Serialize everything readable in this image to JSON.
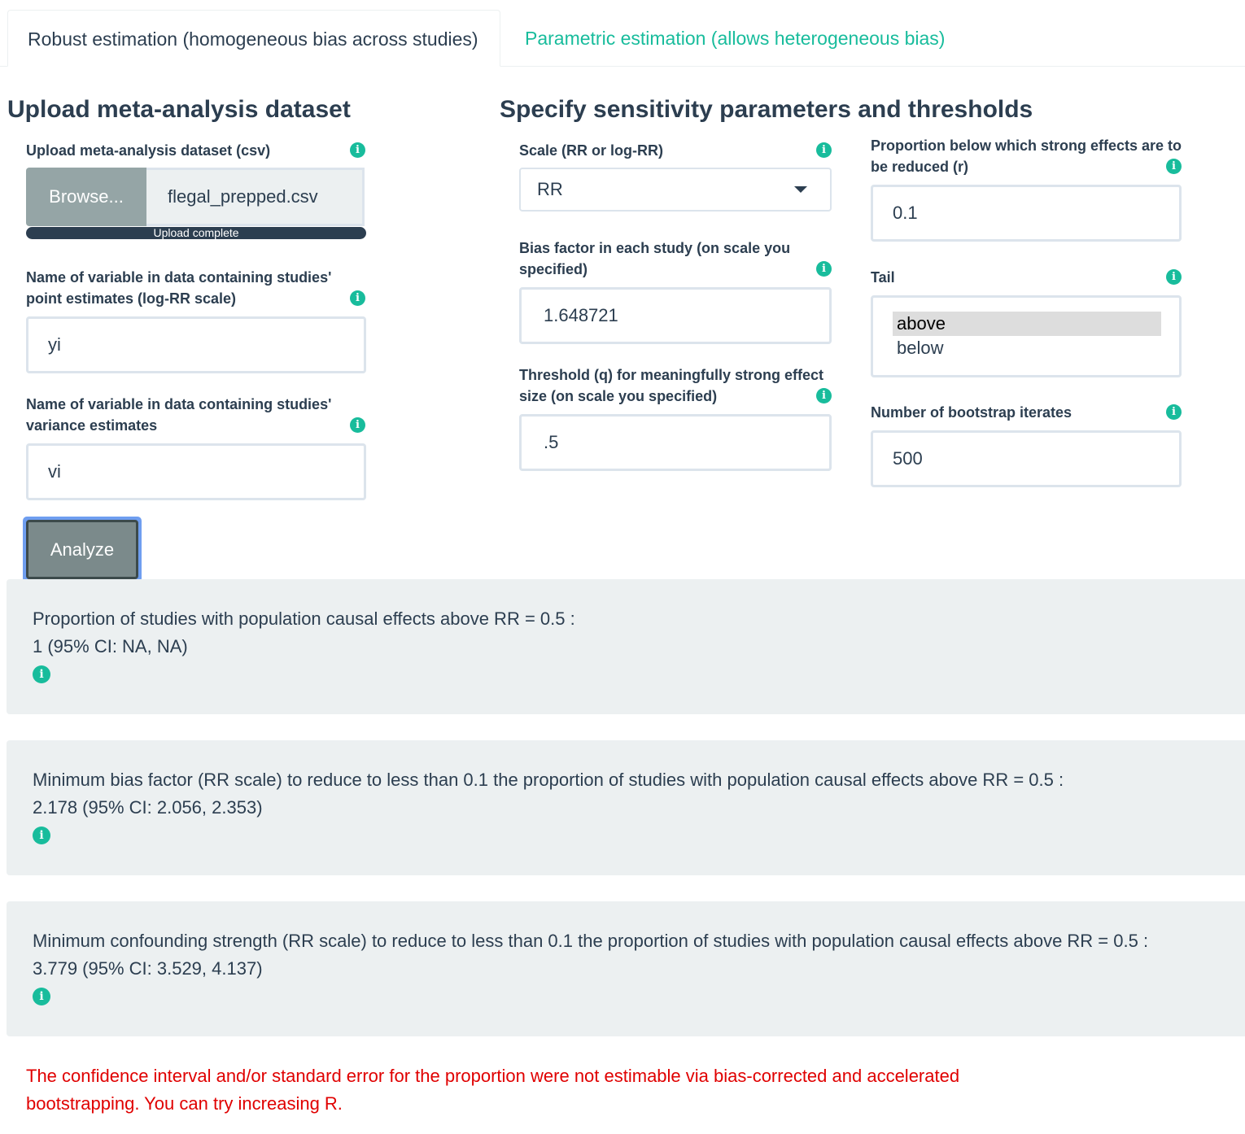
{
  "tabs": [
    {
      "label": "Robust estimation (homogeneous bias across studies)",
      "active": true
    },
    {
      "label": "Parametric estimation (allows heterogeneous bias)",
      "active": false
    }
  ],
  "upload_section": {
    "heading": "Upload meta-analysis dataset",
    "file_label": "Upload meta-analysis dataset (csv)",
    "browse_label": "Browse...",
    "file_name": "flegal_prepped.csv",
    "progress_text": "Upload complete",
    "point_label": "Name of variable in data containing studies' point estimates (log-RR scale)",
    "point_value": "yi",
    "variance_label": "Name of variable in data containing studies' variance estimates",
    "variance_value": "vi",
    "analyze_label": "Analyze"
  },
  "params_section": {
    "heading": "Specify sensitivity parameters and thresholds",
    "scale_label": "Scale (RR or log-RR)",
    "scale_value": "RR",
    "bias_label": "Bias factor in each study (on scale you specified)",
    "bias_value": "1.648721",
    "threshold_label": "Threshold (q) for meaningfully strong effect size (on scale you specified)",
    "threshold_value": ".5",
    "prop_label": "Proportion below which strong effects are to be reduced (r)",
    "prop_value": "0.1",
    "tail_label": "Tail",
    "tail_options": [
      "above",
      "below"
    ],
    "tail_selected": "above",
    "boot_label": "Number of bootstrap iterates",
    "boot_value": "500"
  },
  "results": [
    {
      "line1": "Proportion of studies with population causal effects above RR = 0.5 :",
      "line2": "1 (95% CI: NA, NA)"
    },
    {
      "line1": "Minimum bias factor (RR scale) to reduce to less than 0.1 the proportion of studies with population causal effects above RR = 0.5 :",
      "line2": "2.178 (95% CI: 2.056, 2.353)"
    },
    {
      "line1": "Minimum confounding strength (RR scale) to reduce to less than 0.1 the proportion of studies with population causal effects above RR = 0.5 :",
      "line2": "3.779 (95% CI: 3.529, 4.137)"
    }
  ],
  "error_message": "The confidence interval and/or standard error for the proportion were not estimable via bias-corrected and accelerated bootstrapping. You can try increasing R.",
  "info_icon_glyph": "i",
  "colors": {
    "accent": "#18bc9c",
    "text": "#2c3e50",
    "well": "#ecf0f1",
    "error": "#e00000"
  }
}
